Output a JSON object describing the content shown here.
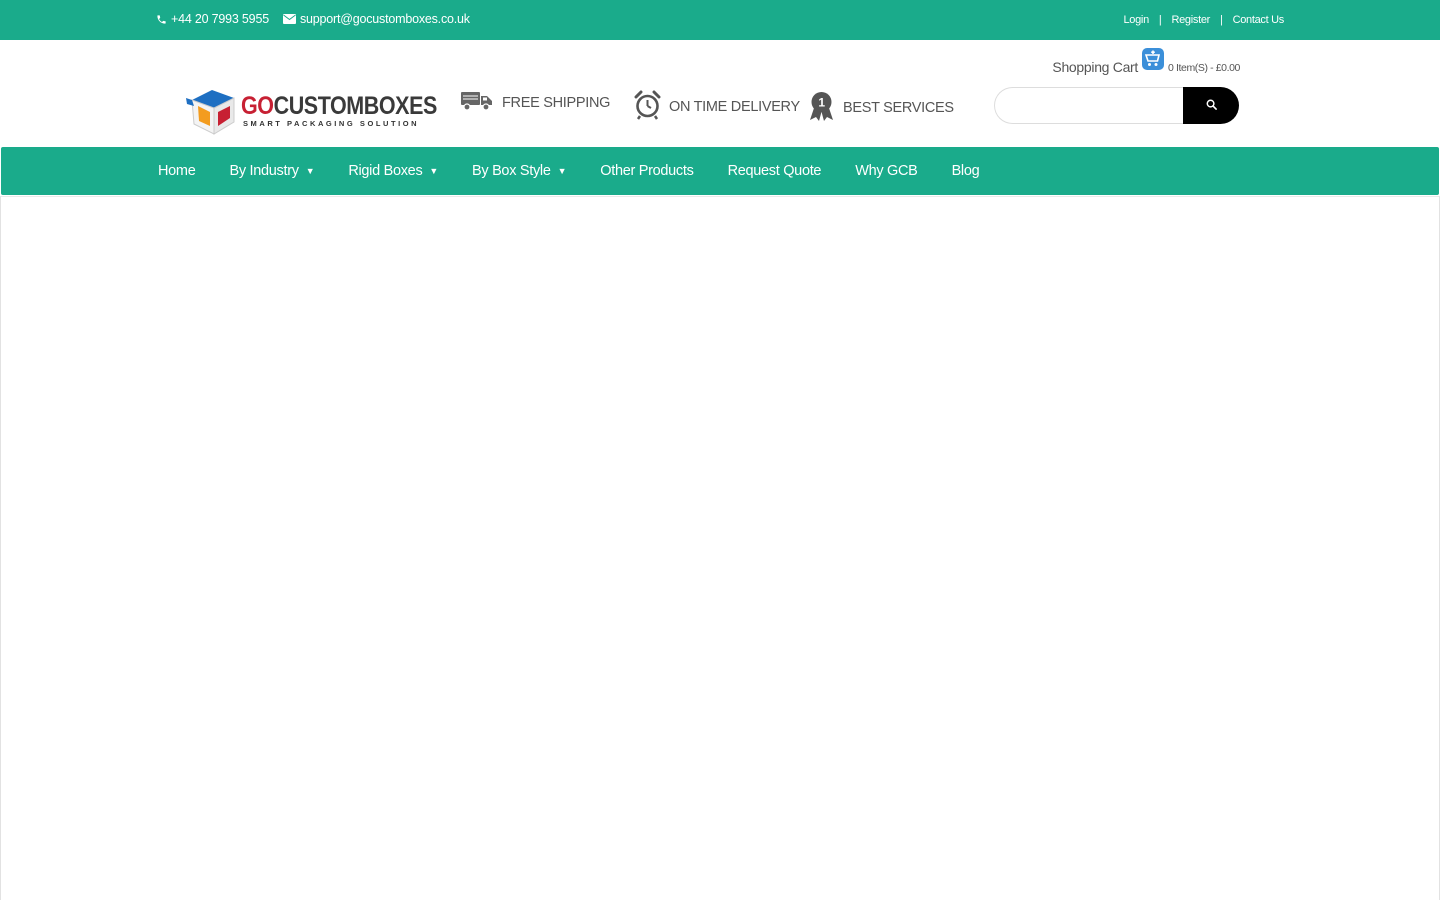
{
  "topbar": {
    "phone": "+44 20 7993 5955",
    "email": "support@gocustomboxes.co.uk",
    "links": [
      "Login",
      "Register",
      "Contact Us"
    ],
    "separator": "|"
  },
  "logo": {
    "brand_go": "GO",
    "brand_rest": "CUSTOMBOXES",
    "tagline": "SMART PACKAGING SOLUTION"
  },
  "features": [
    {
      "label": "FREE SHIPPING",
      "icon": "truck-icon"
    },
    {
      "label": "ON TIME DELIVERY",
      "icon": "alarm-clock-icon"
    },
    {
      "label": "BEST SERVICES",
      "icon": "award-ribbon-icon"
    }
  ],
  "cart": {
    "label": "Shopping Cart",
    "info": "0 Item(S) - £0.00"
  },
  "search": {
    "placeholder": ""
  },
  "nav": {
    "items": [
      {
        "label": "Home",
        "dropdown": false
      },
      {
        "label": "By Industry",
        "dropdown": true
      },
      {
        "label": "Rigid Boxes",
        "dropdown": true
      },
      {
        "label": "By Box Style",
        "dropdown": true
      },
      {
        "label": "Other Products",
        "dropdown": false
      },
      {
        "label": "Request Quote",
        "dropdown": false
      },
      {
        "label": "Why GCB",
        "dropdown": false
      },
      {
        "label": "Blog",
        "dropdown": false
      }
    ],
    "caret": "▼"
  },
  "colors": {
    "accent": "#1aab8b",
    "brand_red": "#c72033",
    "search_button": "#000000"
  }
}
